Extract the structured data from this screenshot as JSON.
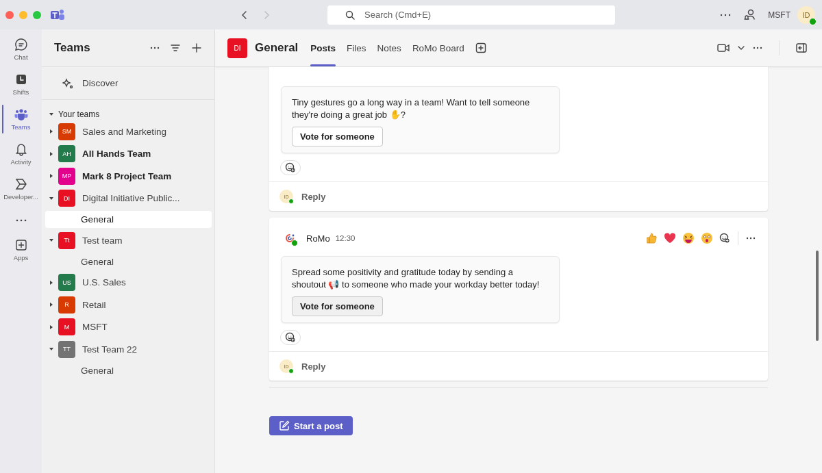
{
  "title_bar": {
    "search": {
      "placeholder": "Search (Cmd+E)"
    },
    "org": "MSFT",
    "avatar": "ID",
    "online": true
  },
  "app_rail": [
    {
      "label": "Chat",
      "selected": false
    },
    {
      "label": "Shifts",
      "selected": false
    },
    {
      "label": "Teams",
      "selected": true
    },
    {
      "label": "Activity",
      "selected": false
    },
    {
      "label": "Developer...",
      "selected": false
    },
    {
      "label": "Apps",
      "selected": false
    }
  ],
  "teams_panel": {
    "title": "Teams",
    "discover": "Discover",
    "section": {
      "label": "Your teams",
      "expanded": true
    },
    "teams": [
      {
        "initials": "SM",
        "color": "#d83b01",
        "name": "Sales and Marketing",
        "unread": false,
        "expanded": false
      },
      {
        "initials": "AH",
        "color": "#237b4b",
        "name": "All Hands Team",
        "unread": true,
        "expanded": false
      },
      {
        "initials": "MP",
        "color": "#e3008c",
        "name": "Mark 8 Project Team",
        "unread": true,
        "expanded": false
      },
      {
        "initials": "DI",
        "color": "#e81123",
        "name": "Digital Initiative Public...",
        "unread": false,
        "expanded": true,
        "channels": [
          {
            "name": "General",
            "selected": true
          }
        ]
      },
      {
        "initials": "Tt",
        "color": "#e81123",
        "name": "Test team",
        "unread": false,
        "expanded": true,
        "channels": [
          {
            "name": "General",
            "selected": false
          }
        ]
      },
      {
        "initials": "US",
        "color": "#237b4b",
        "name": "U.S. Sales",
        "unread": false,
        "expanded": false
      },
      {
        "initials": "R",
        "color": "#d83b01",
        "name": "Retail",
        "unread": false,
        "expanded": false
      },
      {
        "initials": "M",
        "color": "#e81123",
        "name": "MSFT",
        "unread": false,
        "expanded": false
      },
      {
        "initials": "TT",
        "color": "#737373",
        "name": "Test Team 22",
        "unread": false,
        "expanded": true,
        "channels": [
          {
            "name": "General",
            "selected": false
          }
        ]
      }
    ]
  },
  "channel_header": {
    "initials": "DI",
    "color": "#e81123",
    "title": "General",
    "tabs": [
      {
        "label": "Posts",
        "selected": true
      },
      {
        "label": "Files",
        "selected": false
      },
      {
        "label": "Notes",
        "selected": false
      },
      {
        "label": "RoMo Board",
        "selected": false
      }
    ]
  },
  "posts": [
    {
      "body": "Tiny gestures go a long way in a team! Want to tell someone they're doing a great job ✋?",
      "button": "Vote for someone",
      "reply": "Reply",
      "reply_avatar": "ID"
    },
    {
      "author": "RoMo",
      "time": "12:30",
      "body": "Spread some positivity and gratitude today by sending a shoutout 📢 to someone who made your workday better today!",
      "button": "Vote for someone",
      "reply": "Reply",
      "reply_avatar": "ID"
    }
  ],
  "start_post": "Start a post"
}
